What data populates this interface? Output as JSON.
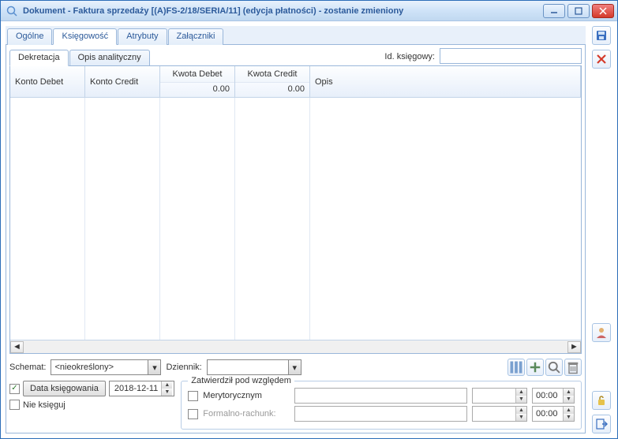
{
  "window": {
    "title": "Dokument - Faktura sprzedaży [(A)FS-2/18/SERIA/11] (edycja płatności) - zostanie zmieniony"
  },
  "tabs": {
    "items": [
      "Ogólne",
      "Księgowość",
      "Atrybuty",
      "Załączniki"
    ],
    "active": 1
  },
  "inner_tabs": {
    "items": [
      "Dekretacja",
      "Opis analityczny"
    ],
    "active": 0
  },
  "id_field": {
    "label": "Id. księgowy:",
    "value": ""
  },
  "grid": {
    "headers": {
      "konto_debet": "Konto Debet",
      "konto_credit": "Konto Credit",
      "kwota_debet": "Kwota Debet",
      "kwota_credit": "Kwota Credit",
      "opis": "Opis"
    },
    "sums": {
      "kwota_debet": "0.00",
      "kwota_credit": "0.00"
    },
    "rows": []
  },
  "schemat": {
    "label": "Schemat:",
    "value": "<nieokreślony>"
  },
  "dziennik": {
    "label": "Dziennik:",
    "value": ""
  },
  "data_ksiegowania": {
    "checked": true,
    "button": "Data księgowania",
    "value": "2018-12-11"
  },
  "nie_ksieguj": {
    "checked": false,
    "label": "Nie księguj"
  },
  "zatwierdzil": {
    "legend": "Zatwierdził pod względem",
    "merytorycznym": {
      "checked": false,
      "label": "Merytorycznym",
      "value": "",
      "num": "",
      "time": "00:00"
    },
    "formalno": {
      "checked": false,
      "label": "Formalno-rachunk:",
      "value": "",
      "num": "",
      "time": "00:00"
    }
  }
}
